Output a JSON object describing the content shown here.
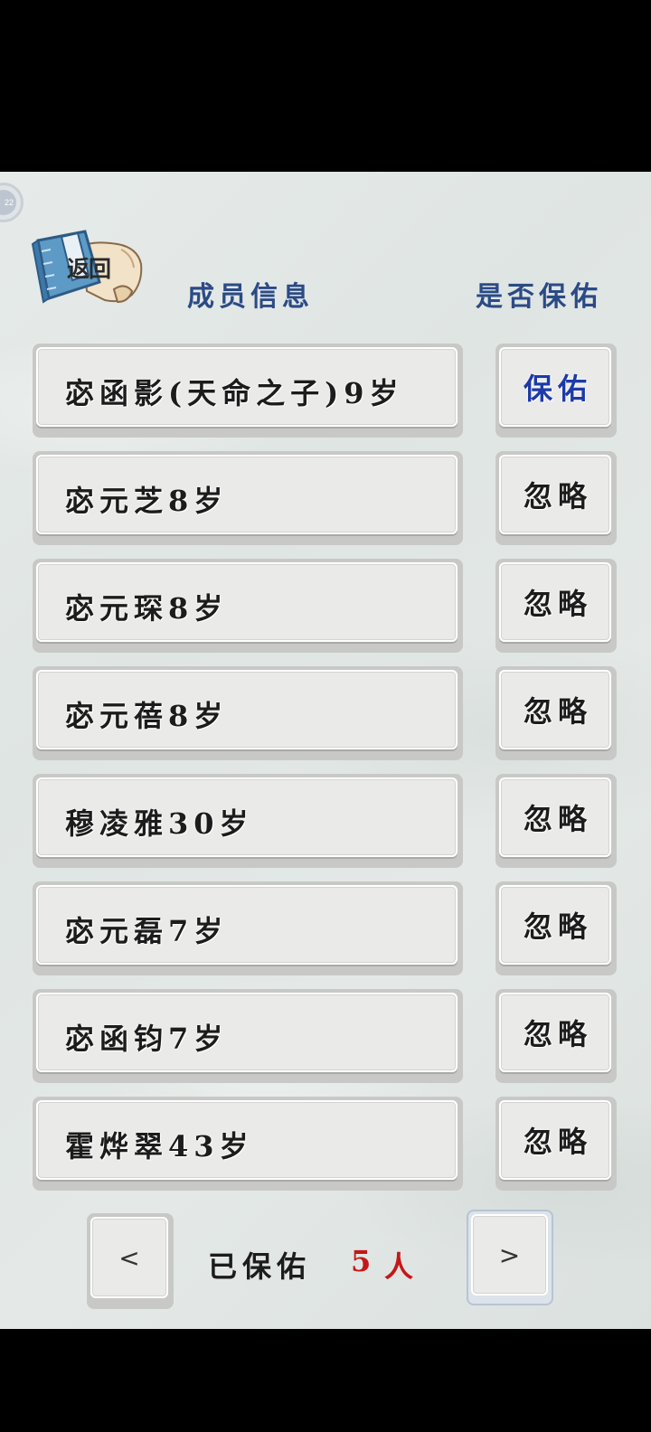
{
  "header": {
    "back_label": "返回",
    "col_member_info": "成员信息",
    "col_protect": "是否保佑"
  },
  "members": [
    {
      "name": "宓函影(天命之子)9岁",
      "action": "保佑",
      "active": true
    },
    {
      "name": "宓元芝8岁",
      "action": "忽略",
      "active": false
    },
    {
      "name": "宓元琛8岁",
      "action": "忽略",
      "active": false
    },
    {
      "name": "宓元蓓8岁",
      "action": "忽略",
      "active": false
    },
    {
      "name": "穆凌雅30岁",
      "action": "忽略",
      "active": false
    },
    {
      "name": "宓元磊7岁",
      "action": "忽略",
      "active": false
    },
    {
      "name": "宓函钧7岁",
      "action": "忽略",
      "active": false
    },
    {
      "name": "霍烨翠43岁",
      "action": "忽略",
      "active": false
    }
  ],
  "footer": {
    "prev_label": "<",
    "next_label": ">",
    "count_prefix": "已保佑",
    "count_value": "5",
    "count_unit": "人"
  },
  "colors": {
    "header_blue": "#2b4a86",
    "active_blue": "#1d3aa8",
    "count_red": "#c41818"
  },
  "icons": {
    "back": "book-scroll-icon",
    "badge": "version-badge-icon"
  }
}
